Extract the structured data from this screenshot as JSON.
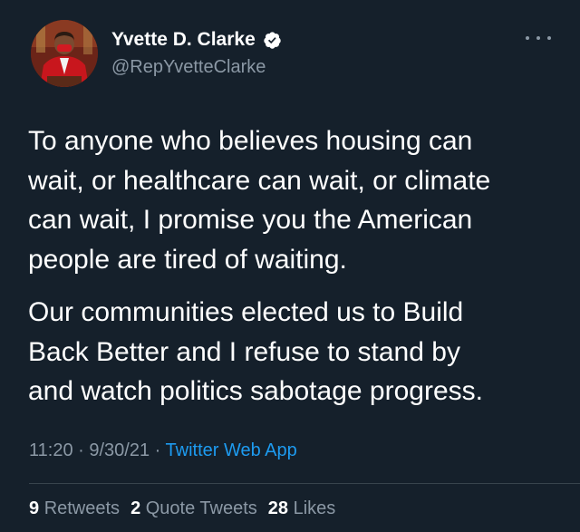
{
  "author": {
    "display_name": "Yvette D. Clarke",
    "handle": "@RepYvetteClarke",
    "verified": true,
    "avatar_icon": "profile-photo"
  },
  "tweet": {
    "paragraphs": [
      "To anyone who believes housing can\nwait, or healthcare can wait, or climate\ncan wait, I promise you the American\npeople are tired of waiting.",
      "Our communities elected us to Build\nBack Better and I refuse to stand by\nand watch politics sabotage progress."
    ]
  },
  "meta": {
    "time": "11:20",
    "separator": " · ",
    "date": "9/30/21",
    "source": "Twitter Web App"
  },
  "stats": {
    "retweets_count": "9",
    "retweets_label": "Retweets",
    "quotes_count": "2",
    "quotes_label": "Quote Tweets",
    "likes_count": "28",
    "likes_label": "Likes"
  },
  "colors": {
    "background": "#15202b",
    "text_primary": "#ffffff",
    "text_secondary": "#8b98a5",
    "link": "#1d9bf0",
    "divider": "#38444d"
  }
}
